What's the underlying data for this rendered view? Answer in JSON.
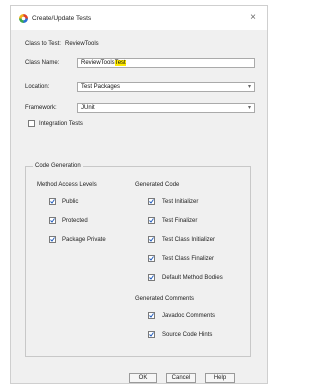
{
  "dialog": {
    "title": "Create/Update Tests",
    "close_glyph": "×",
    "class_to_test_label": "Class to Test:",
    "class_to_test_value": "ReviewTools",
    "class_name_label": "Class Name:",
    "class_name_prefix": "ReviewTools",
    "class_name_highlight": "Test",
    "location_label": "Location:",
    "location_value": "Test Packages",
    "framework_label": "Framework:",
    "framework_value": "JUnit",
    "integration_tests_label": "Integration Tests",
    "integration_tests_checked": false
  },
  "code_generation": {
    "title": "Code Generation",
    "method_access_levels": {
      "heading": "Method Access Levels",
      "items": [
        {
          "label": "Public",
          "checked": true
        },
        {
          "label": "Protected",
          "checked": true
        },
        {
          "label": "Package Private",
          "checked": true
        }
      ]
    },
    "generated_code": {
      "heading": "Generated Code",
      "items": [
        {
          "label": "Test Initializer",
          "checked": true
        },
        {
          "label": "Test Finalizer",
          "checked": true
        },
        {
          "label": "Test Class Initializer",
          "checked": true
        },
        {
          "label": "Test Class Finalizer",
          "checked": true
        },
        {
          "label": "Default Method Bodies",
          "checked": true
        }
      ]
    },
    "generated_comments": {
      "heading": "Generated Comments",
      "items": [
        {
          "label": "Javadoc Comments",
          "checked": true
        },
        {
          "label": "Source Code Hints",
          "checked": true
        }
      ]
    }
  },
  "buttons": {
    "ok": "OK",
    "cancel": "Cancel",
    "help": "Help"
  },
  "colors": {
    "highlight": "#ffea00",
    "dialog_bg": "#f0f0f0",
    "icon_red": "#e0402a",
    "icon_blue": "#2a6fd6"
  }
}
